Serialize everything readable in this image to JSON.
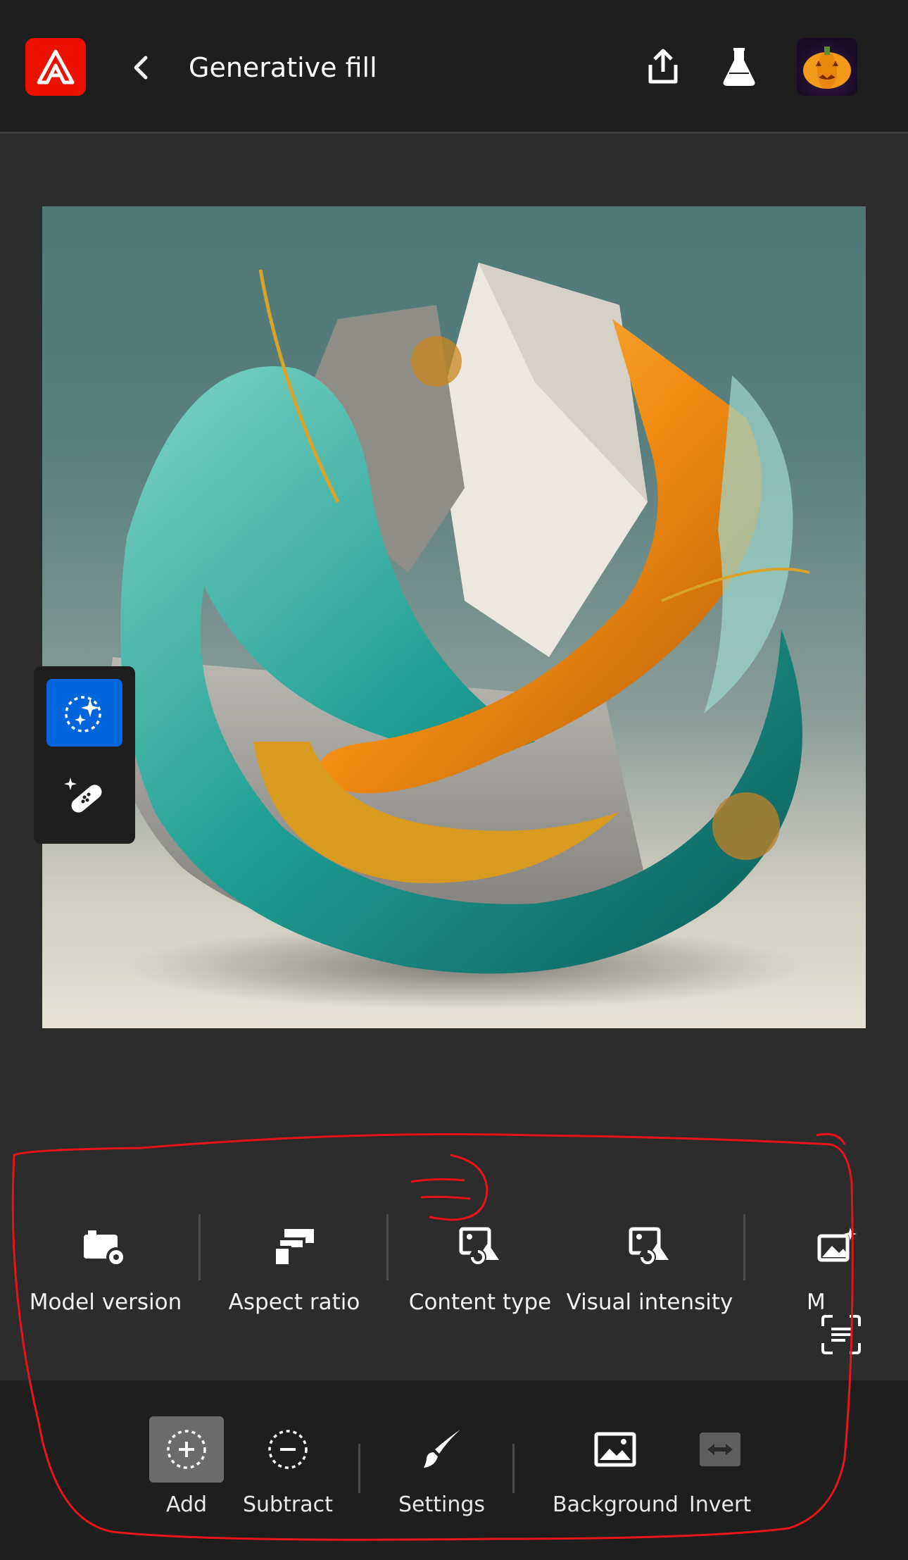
{
  "header": {
    "title": "Generative fill",
    "logo_icon": "adobe-firefly-logo-icon",
    "back_icon": "chevron-left-icon",
    "share_icon": "share-icon",
    "beta_icon": "flask-icon",
    "avatar_icon": "pumpkin-avatar"
  },
  "tool_rail": {
    "items": [
      {
        "name": "generative-fill-tool",
        "icon": "sparkle-selection-icon",
        "active": true
      },
      {
        "name": "remove-tool",
        "icon": "sparkle-bandage-icon",
        "active": false
      }
    ]
  },
  "options": {
    "items": [
      {
        "label": "Model version",
        "icon": "model-settings-icon"
      },
      {
        "label": "Aspect ratio",
        "icon": "aspect-ratio-icon"
      },
      {
        "label": "Content type",
        "icon": "content-type-icon"
      },
      {
        "label": "Visual intensity",
        "icon": "visual-intensity-icon"
      },
      {
        "label": "M... ",
        "icon": "image-sparkle-icon"
      }
    ]
  },
  "bottom_bar": {
    "items": [
      {
        "label": "Add",
        "icon": "add-selection-icon",
        "active": true
      },
      {
        "label": "Subtract",
        "icon": "subtract-selection-icon",
        "active": false
      },
      {
        "label": "Settings",
        "icon": "brush-icon",
        "active": false
      },
      {
        "label": "Background",
        "icon": "image-icon",
        "active": false
      },
      {
        "label": "Invert",
        "icon": "invert-icon",
        "active": false
      }
    ]
  },
  "colors": {
    "accent": "#0265dc",
    "brand": "#eb1000",
    "annotation": "#e8141c"
  }
}
